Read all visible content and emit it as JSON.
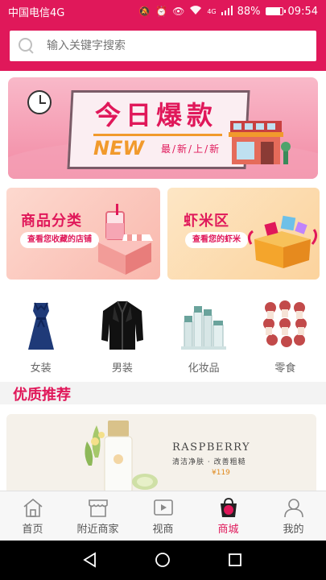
{
  "status_bar": {
    "carrier": "中国电信4G",
    "network_tag": "4G",
    "battery": "88%",
    "battery_level": 0.88,
    "time": "09:54"
  },
  "search": {
    "placeholder": "输入关键字搜索"
  },
  "banner": {
    "title": "今日爆款",
    "badge": "NEW",
    "subtitle": "最/新/上/新"
  },
  "cards": [
    {
      "title": "商品分类",
      "button": "查看您收藏的店铺"
    },
    {
      "title": "虾米区",
      "button": "查看您的虾米"
    }
  ],
  "categories": [
    {
      "label": "女装",
      "icon": "dress-icon"
    },
    {
      "label": "男装",
      "icon": "leather-jacket-icon"
    },
    {
      "label": "化妆品",
      "icon": "cosmetics-icon"
    },
    {
      "label": "零食",
      "icon": "snacks-icon"
    }
  ],
  "section": {
    "title": "优质推荐"
  },
  "promo": {
    "brand": "RASPBERRY",
    "subtitle": "清洁净肤 · 改善粗糙",
    "price": "¥119"
  },
  "tabs": [
    {
      "label": "首页",
      "icon": "home-icon",
      "active": false
    },
    {
      "label": "附近商家",
      "icon": "store-icon",
      "active": false
    },
    {
      "label": "视商",
      "icon": "video-icon",
      "active": false
    },
    {
      "label": "商城",
      "icon": "shopping-bag-icon",
      "active": true
    },
    {
      "label": "我的",
      "icon": "user-icon",
      "active": false
    }
  ],
  "colors": {
    "brand": "#e0185a",
    "accent": "#f19a2c"
  }
}
